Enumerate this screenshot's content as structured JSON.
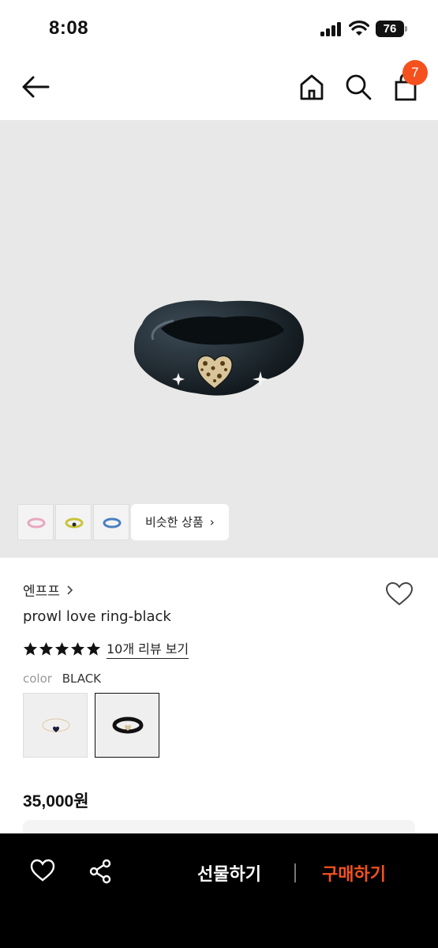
{
  "status_bar": {
    "time": "8:08",
    "battery": "76"
  },
  "header": {
    "cart_count": "7"
  },
  "gallery": {
    "similar_label": "비슷한 상품",
    "thumb_colors": [
      "#e8a7c0",
      "#c9c33a",
      "#4a7fc1"
    ]
  },
  "product": {
    "brand": "엔프프",
    "name": "prowl love ring-black",
    "rating_stars": 5,
    "review_link": "10개 리뷰 보기",
    "color_label": "color",
    "color_value": "BLACK",
    "variants": [
      {
        "name": "white",
        "selected": false
      },
      {
        "name": "black",
        "selected": true
      }
    ],
    "price": "35,000원"
  },
  "bottom_bar": {
    "gift_label": "선물하기",
    "buy_label": "구매하기"
  },
  "colors": {
    "accent": "#f4511e",
    "hero_bg": "#e8e8e8",
    "bottom_bg": "#000000"
  }
}
